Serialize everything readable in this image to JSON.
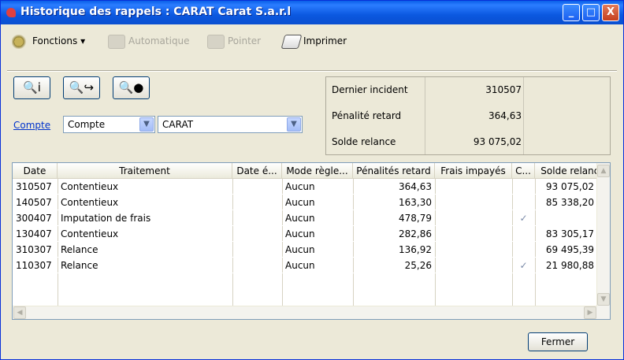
{
  "window": {
    "title": "Historique des rappels :  CARAT Carat S.a.r.l"
  },
  "titlebar_buttons": {
    "minimize": "_",
    "maximize": "□",
    "close": "X"
  },
  "toolbar": {
    "functions_label": "Fonctions ▾",
    "automatic_label": "Automatique",
    "pointer_label": "Pointer",
    "print_label": "Imprimer"
  },
  "actions": {
    "btn1": "🔍i",
    "btn2": "🔍↪",
    "btn3": "🔍●"
  },
  "account": {
    "link": "Compte",
    "type_value": "Compte",
    "account_value": "CARAT"
  },
  "info": {
    "rows": [
      {
        "label": "Dernier incident",
        "value": "310507"
      },
      {
        "label": "Pénalité retard",
        "value": "364,63"
      },
      {
        "label": "Solde relance",
        "value": "93 075,02"
      }
    ]
  },
  "table": {
    "headers": [
      "Date",
      "Traitement",
      "Date é...",
      "Mode règle...",
      "Pénalités retard",
      "Frais impayés",
      "C...",
      "Solde relance"
    ],
    "rows": [
      {
        "date": "310507",
        "traitement": "Contentieux",
        "date_e": "",
        "mode": "Aucun",
        "penalites": "364,63",
        "frais": "",
        "c": "",
        "solde": "93 075,02"
      },
      {
        "date": "140507",
        "traitement": "Contentieux",
        "date_e": "",
        "mode": "Aucun",
        "penalites": "163,30",
        "frais": "",
        "c": "",
        "solde": "85 338,20"
      },
      {
        "date": "300407",
        "traitement": "Imputation de frais",
        "date_e": "",
        "mode": "Aucun",
        "penalites": "478,79",
        "frais": "",
        "c": "✓",
        "solde": ""
      },
      {
        "date": "130407",
        "traitement": "Contentieux",
        "date_e": "",
        "mode": "Aucun",
        "penalites": "282,86",
        "frais": "",
        "c": "",
        "solde": "83 305,17"
      },
      {
        "date": "310307",
        "traitement": "Relance",
        "date_e": "",
        "mode": "Aucun",
        "penalites": "136,92",
        "frais": "",
        "c": "",
        "solde": "69 495,39"
      },
      {
        "date": "110307",
        "traitement": "Relance",
        "date_e": "",
        "mode": "Aucun",
        "penalites": "25,26",
        "frais": "",
        "c": "✓",
        "solde": "21 980,88"
      }
    ]
  },
  "footer": {
    "close_label": "Fermer"
  },
  "colors": {
    "titlebar": "#0a5fe8",
    "link": "#0033cc",
    "window_bg": "#ece9d8"
  }
}
